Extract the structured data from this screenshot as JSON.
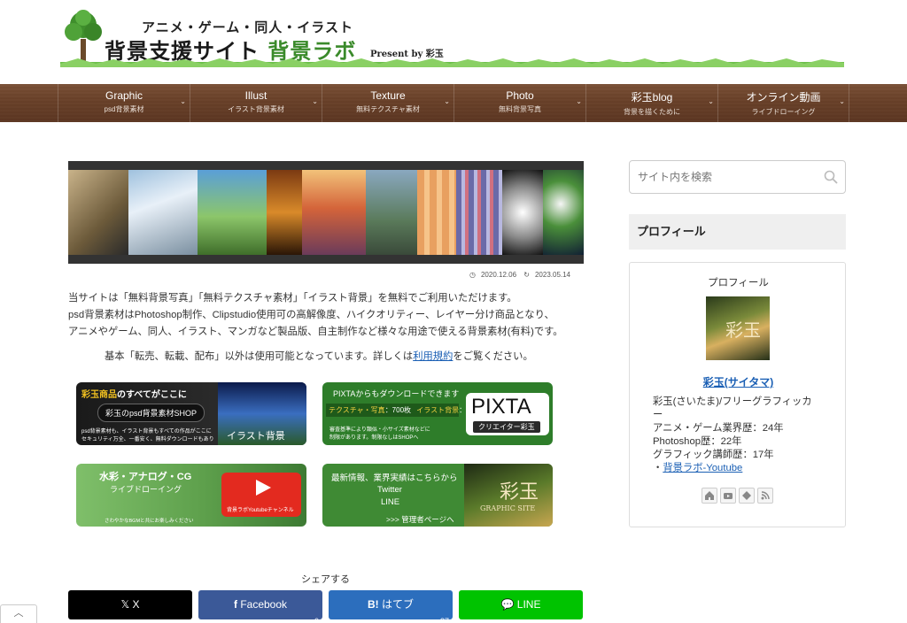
{
  "header": {
    "subtitle": "アニメ・ゲーム・同人・イラスト",
    "title_main": "背景支援サイト",
    "title_accent": "背景ラボ",
    "present": "Present by 彩玉"
  },
  "nav": [
    {
      "label": "Graphic",
      "sub": "psd背景素材"
    },
    {
      "label": "Illust",
      "sub": "イラスト背景素材"
    },
    {
      "label": "Texture",
      "sub": "無料テクスチャ素材"
    },
    {
      "label": "Photo",
      "sub": "無料背景写真"
    },
    {
      "label": "彩玉blog",
      "sub": "背景を描くために"
    },
    {
      "label": "オンライン動画",
      "sub": "ライブドローイング"
    }
  ],
  "post": {
    "date_published": "2020.12.06",
    "date_updated": "2023.05.14",
    "intro_lines": [
      "当サイトは「無料背景写真」「無料テクスチャ素材」「イラスト背景」を無料でご利用いただけます。",
      "psd背景素材はPhotoshop制作、Clipstudio使用可の高解像度、ハイクオリティー、レイヤー分け商品となり、",
      "アニメやゲーム、同人、イラスト、マンガなど製品版、自主制作など様々な用途で使える背景素材(有料)です。"
    ],
    "notice_before": "基本「転売、転載、配布」以外は使用可能となっています。詳しくは",
    "notice_link": "利用規約",
    "notice_after": "をご覧ください。"
  },
  "banners": {
    "shop": {
      "heading_accent": "彩玉商品",
      "heading_rest": "のすべてがここに",
      "pill": "彩玉のpsd背景素材SHOP",
      "small1": "psd背景素材も、イラスト背景もすべての作品がここに",
      "small2": "セキュリティ万全、一番安く、無料ダウンロードもあり",
      "overlay": "イラスト背景"
    },
    "pixta": {
      "heading": "PIXTAからもダウンロードできます",
      "tag_left": "テクスチャ・写真",
      "count1": "：700枚",
      "tag_right": "イラスト背景",
      "count2": "：300枚",
      "small1": "審査基準により類似・小サイズ素材などに",
      "small2": "制限があります。制限なしはSHOPへ",
      "logo": "PIXTA",
      "creator": "クリエイター彩玉"
    },
    "live": {
      "heading": "水彩・アナログ・CG",
      "sub": "ライブドローイング",
      "channel": "背景ラボYoutubeチャンネル",
      "small": "さわやかなBGMと共にお楽しみください"
    },
    "admin": {
      "heading": "最新情報、業界実績はこちらから",
      "line1": "Twitter",
      "line2": "LINE",
      "link": ">>> 管理者ページへ",
      "logo": "彩玉",
      "logo_sub": "GRAPHIC SITE"
    }
  },
  "share": {
    "title": "シェアする",
    "buttons": [
      {
        "label": "X",
        "count": "",
        "color": "#000000"
      },
      {
        "label": "Facebook",
        "count": "0",
        "color": "#3b5998"
      },
      {
        "label": "はてブ",
        "count": "87",
        "color": "#2c6ebd"
      },
      {
        "label": "LINE",
        "count": "",
        "color": "#00c300"
      }
    ]
  },
  "sidebar": {
    "search_placeholder": "サイト内を検索",
    "widget_title": "プロフィール",
    "profile_label": "プロフィール",
    "profile_name": "彩玉(サイタマ)",
    "desc_lines": [
      "彩玉(さいたま)/フリーグラフィッカ",
      "ー",
      "アニメ・ゲーム業界歴：24年",
      "Photoshop歴：22年",
      "グラフィック講師歴：17年"
    ],
    "link_prefix": "・",
    "link_label": "背景ラボ-Youtube"
  },
  "icons": [
    "tree-icon",
    "search-icon",
    "clock-icon",
    "refresh-icon",
    "play-icon",
    "home-icon",
    "youtube-icon",
    "feedly-icon",
    "rss-icon",
    "chevron-up-icon"
  ]
}
